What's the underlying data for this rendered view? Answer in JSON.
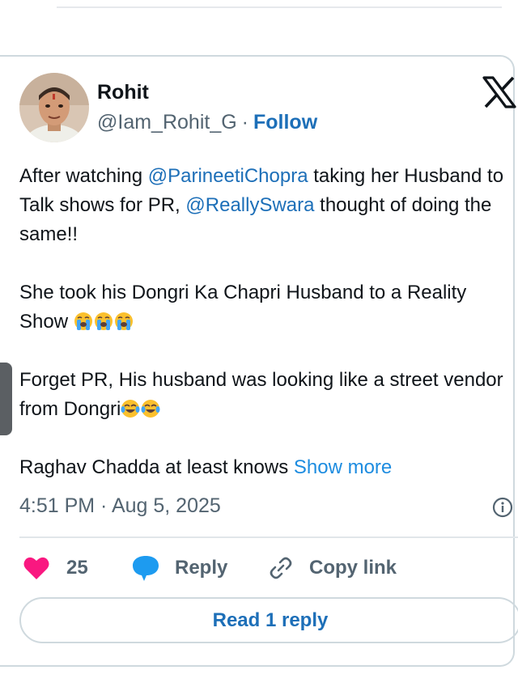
{
  "tweet": {
    "author_name": "Rohit",
    "handle": "@Iam_Rohit_G",
    "separator": "·",
    "follow_label": "Follow",
    "para1": {
      "t1": "After watching ",
      "m1": "@ParineetiChopra",
      "t2": " taking her Husband to Talk shows for PR, ",
      "m2": "@ReallySwara",
      "t3": " thought of doing the same!!"
    },
    "para2": {
      "text": "She took his Dongri Ka Chapri Husband to a Reality Show "
    },
    "para3": {
      "text": "Forget PR, His husband was looking like a street vendor from Dongri"
    },
    "para4": {
      "text": "Raghav Chadda at least knows ",
      "show_more": "Show more"
    },
    "timestamp": "4:51 PM · Aug 5, 2025"
  },
  "actions": {
    "like_count": "25",
    "reply_label": "Reply",
    "copy_label": "Copy link"
  },
  "read_replies_label": "Read 1 reply",
  "icons": {
    "platform": "x-logo-icon",
    "like": "heart-icon",
    "reply": "speech-bubble-icon",
    "copy": "link-icon",
    "info": "info-icon",
    "emoji_cry": "loudly-crying-face-emoji",
    "emoji_laugh": "tears-of-joy-emoji"
  },
  "colors": {
    "link_blue": "#1d6fb8",
    "show_more_blue": "#1d8ce0",
    "like_pink": "#f91880",
    "reply_blue": "#1d9bf0",
    "secondary_gray": "#536471"
  }
}
